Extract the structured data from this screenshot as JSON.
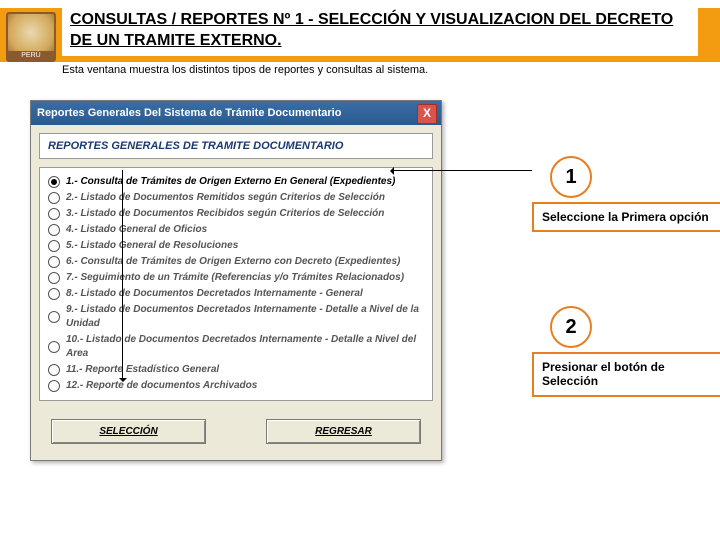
{
  "header": {
    "title": "CONSULTAS / REPORTES Nº 1 - SELECCIÓN Y VISUALIZACION DEL DECRETO DE UN TRAMITE EXTERNO.",
    "subtitle": "Esta ventana muestra los distintos tipos de reportes y consultas al sistema."
  },
  "window": {
    "title": "Reportes Generales Del Sistema de Trámite Documentario",
    "close": "X",
    "panel_title": "REPORTES GENERALES DE TRAMITE DOCUMENTARIO",
    "options": [
      "1.- Consulta de Trámites de Origen Externo En General  (Expedientes)",
      "2.- Listado de Documentos Remitidos según Criterios de Selección",
      "3.- Listado de Documentos Recibidos según Criterios de Selección",
      "4.- Listado General de Oficios",
      "5.- Listado General de Resoluciones",
      "6.- Consulta de Trámites de Origen Externo con Decreto  (Expedientes)",
      "7.- Seguimiento de un Trámite  (Referencias y/o Trámites Relacionados)",
      "8.- Listado de Documentos Decretados Internamente - General",
      "9.- Listado de Documentos Decretados Internamente - Detalle a Nivel de la Unidad",
      "10.- Listado de Documentos Decretados Internamente - Detalle a Nivel del Area",
      "11.- Reporte Estadístico General",
      "12.- Reporte de documentos Archivados"
    ],
    "buttons": {
      "select": "SELECCIÓN",
      "back": "REGRESAR"
    }
  },
  "annotations": {
    "step1_num": "1",
    "step1_text": "Seleccione la Primera opción",
    "step2_num": "2",
    "step2_text": "Presionar el botón de Selección"
  }
}
